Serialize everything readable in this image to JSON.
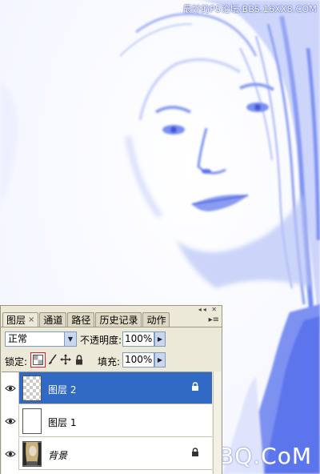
{
  "watermark_top": "最好的PS论坛:BBS.16XX8.COM",
  "watermark_bottom": "UiBQ.CoM",
  "panel": {
    "controls": "◂◂ ✕",
    "tabs": [
      {
        "label": "图层",
        "active": true,
        "close": "×"
      },
      {
        "label": "通道"
      },
      {
        "label": "路径"
      },
      {
        "label": "历史记录"
      },
      {
        "label": "动作"
      }
    ],
    "menu_icon": "▸≡",
    "blend_mode": "正常",
    "opacity_label": "不透明度:",
    "opacity_value": "100%",
    "lock_label": "锁定:",
    "fill_label": "填充:",
    "fill_value": "100%"
  },
  "layers": [
    {
      "name": "图层 2",
      "selected": true,
      "locked": true,
      "thumb": "transparent"
    },
    {
      "name": "图层 1",
      "selected": false,
      "locked": false,
      "thumb": "white"
    },
    {
      "name": "背景",
      "selected": false,
      "locked": true,
      "italic": true,
      "thumb": "photo"
    }
  ],
  "colors": {
    "photo_tint": "#6f86f0",
    "selection": "#316ac5",
    "panel_bg": "#ece9d8"
  }
}
